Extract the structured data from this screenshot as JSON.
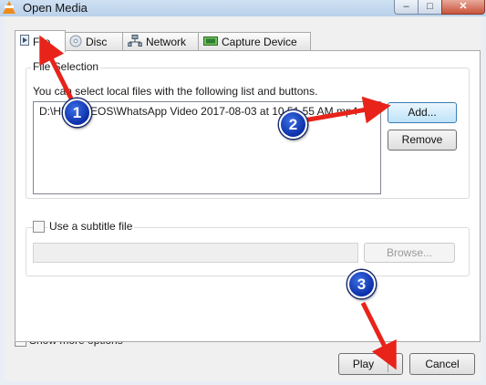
{
  "window": {
    "title": "Open Media",
    "minimize": "–",
    "maximize": "□",
    "close": "✕"
  },
  "tabs": [
    {
      "label": "File",
      "icon": "file-icon"
    },
    {
      "label": "Disc",
      "icon": "disc-icon"
    },
    {
      "label": "Network",
      "icon": "network-icon"
    },
    {
      "label": "Capture Device",
      "icon": "capture-device-icon"
    }
  ],
  "file_selection": {
    "group_label": "File Selection",
    "hint": "You can select local files with the following list and buttons.",
    "files": [
      "D:\\HD VIDEOS\\WhatsApp Video 2017-08-03 at 10.51.55 AM.mp4"
    ],
    "add_label": "Add...",
    "remove_label": "Remove"
  },
  "subtitle": {
    "label": "Use a subtitle file",
    "checked": false,
    "path_value": "",
    "browse_label": "Browse..."
  },
  "footer": {
    "show_more_label": "Show more options",
    "show_more_checked": false,
    "play_label": "Play",
    "cancel_label": "Cancel"
  },
  "annotations": [
    {
      "number": "1"
    },
    {
      "number": "2"
    },
    {
      "number": "3"
    }
  ],
  "colors": {
    "arrow": "#e8231a",
    "badge": "#1d45c9"
  }
}
